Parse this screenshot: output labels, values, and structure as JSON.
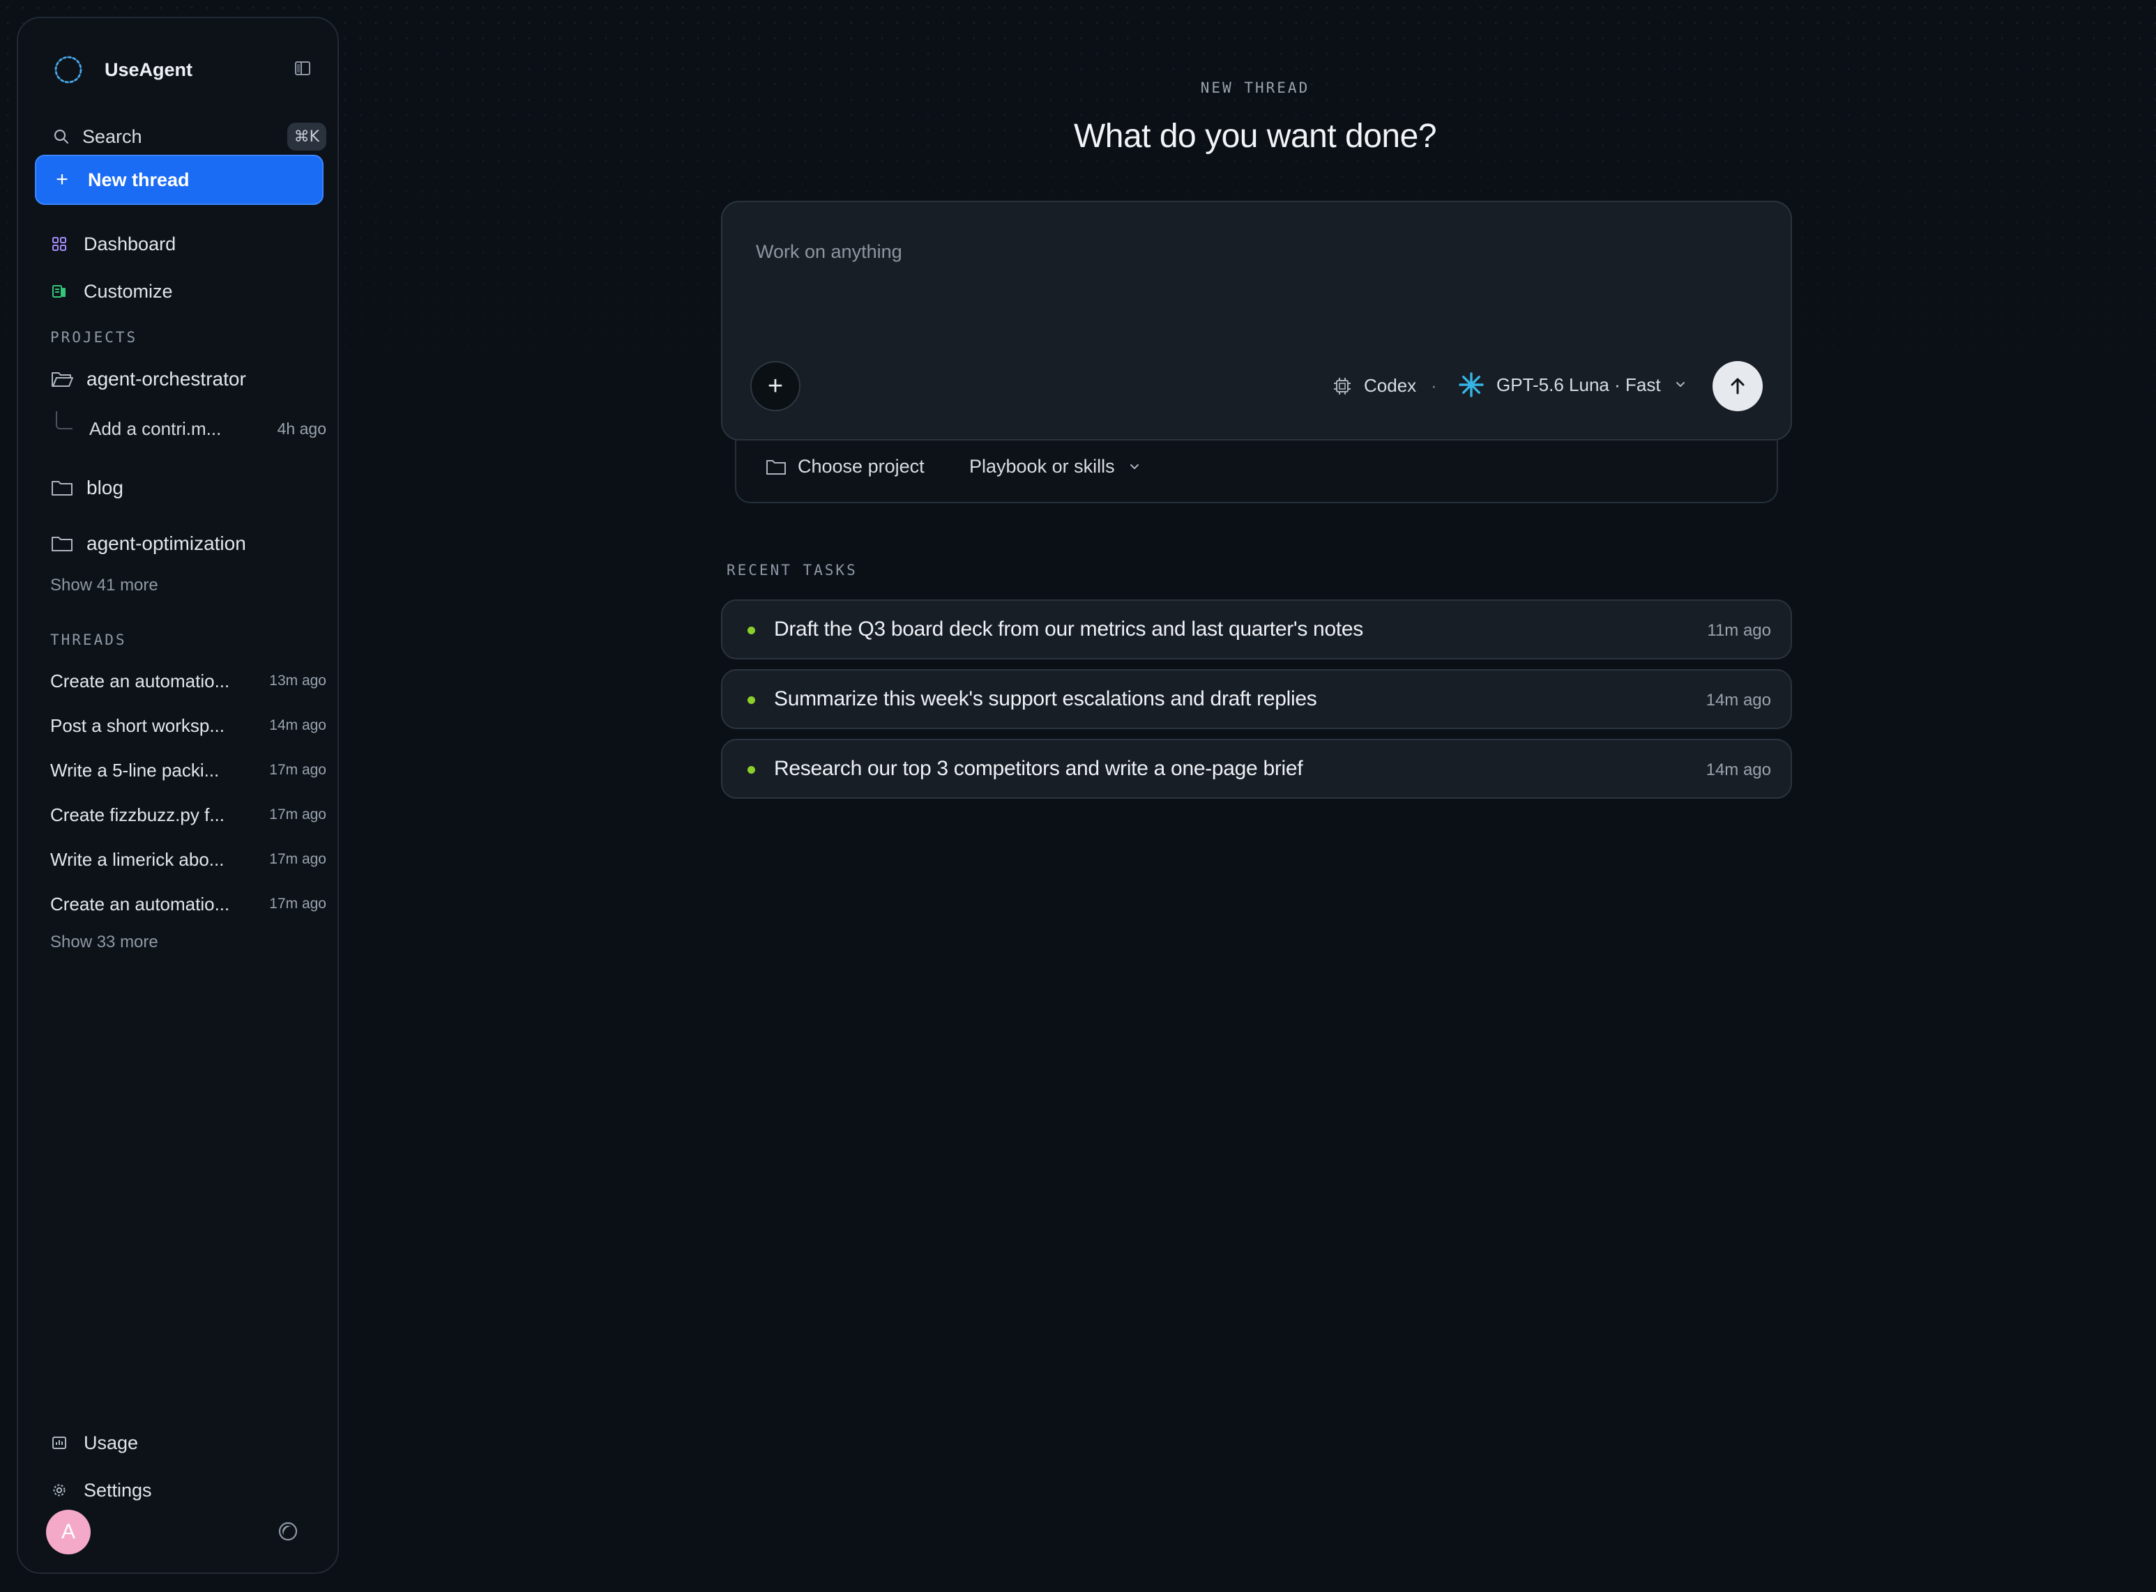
{
  "app": {
    "name": "UseAgent"
  },
  "sidebar": {
    "search_label": "Search",
    "search_shortcut": "⌘K",
    "new_thread_label": "New thread",
    "nav": [
      {
        "label": "Dashboard",
        "icon": "dashboard-icon"
      },
      {
        "label": "Customize",
        "icon": "customize-icon"
      }
    ],
    "projects_heading": "PROJECTS",
    "projects": [
      {
        "label": "agent-orchestrator",
        "icon": "folder-open-icon",
        "children": [
          {
            "label": "Add a contri.m...",
            "time": "4h ago"
          }
        ]
      },
      {
        "label": "blog",
        "icon": "folder-icon"
      },
      {
        "label": "agent-optimization",
        "icon": "folder-icon"
      }
    ],
    "projects_show_more": "Show 41 more",
    "threads_heading": "THREADS",
    "threads": [
      {
        "label": "Create an automatio...",
        "time": "13m ago"
      },
      {
        "label": "Post a short worksp...",
        "time": "14m ago"
      },
      {
        "label": "Write a 5-line packi...",
        "time": "17m ago"
      },
      {
        "label": "Create fizzbuzz.py f...",
        "time": "17m ago"
      },
      {
        "label": "Write a limerick abo...",
        "time": "17m ago"
      },
      {
        "label": "Create an automatio...",
        "time": "17m ago"
      }
    ],
    "threads_show_more": "Show 33 more",
    "footer": [
      {
        "label": "Usage",
        "icon": "usage-icon"
      },
      {
        "label": "Settings",
        "icon": "gear-icon"
      }
    ],
    "avatar_initial": "A"
  },
  "main": {
    "eyebrow": "NEW THREAD",
    "headline": "What do you want done?",
    "composer": {
      "placeholder": "Work on anything",
      "agent_label": "Codex",
      "separator": "·",
      "model_label": "GPT-5.6 Luna · Fast"
    },
    "subbar": {
      "project_label": "Choose project",
      "skills_label": "Playbook or skills"
    },
    "recent_heading": "RECENT TASKS",
    "recent_tasks": [
      {
        "label": "Draft the Q3 board deck from our metrics and last quarter's notes",
        "time": "11m ago"
      },
      {
        "label": "Summarize this week's support escalations and draft replies",
        "time": "14m ago"
      },
      {
        "label": "Research our top 3 competitors and write a one-page brief",
        "time": "14m ago"
      }
    ]
  },
  "colors": {
    "background": "#0a1016",
    "accent": "#1b6cf5",
    "status_dot": "#8ccf2a",
    "avatar": "#f4a9c8"
  }
}
